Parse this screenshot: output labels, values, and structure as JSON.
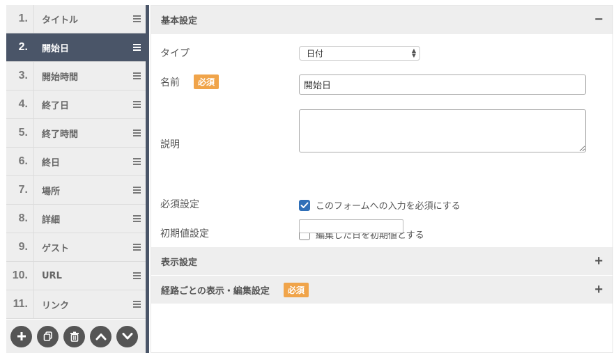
{
  "fields": [
    {
      "num": "1.",
      "label": "タイトル"
    },
    {
      "num": "2.",
      "label": "開始日"
    },
    {
      "num": "3.",
      "label": "開始時間"
    },
    {
      "num": "4.",
      "label": "終了日"
    },
    {
      "num": "5.",
      "label": "終了時間"
    },
    {
      "num": "6.",
      "label": "終日"
    },
    {
      "num": "7.",
      "label": "場所"
    },
    {
      "num": "8.",
      "label": "詳細"
    },
    {
      "num": "9.",
      "label": "ゲスト"
    },
    {
      "num": "10.",
      "label": "URL"
    },
    {
      "num": "11.",
      "label": "リンク"
    }
  ],
  "list_actions": [
    "add-icon",
    "copy-icon",
    "trash-icon",
    "chevron-up-icon",
    "chevron-down-icon"
  ],
  "basic_section": {
    "title": "基本設定",
    "toggle": "−",
    "type_label": "タイプ",
    "type_value": "日付",
    "name_label": "名前",
    "required_badge": "必須",
    "name_value": "開始日",
    "desc_label": "説明",
    "desc_value": "",
    "required_label": "必須設定",
    "required_check_label": "このフォームへの入力を必須にする",
    "required_checked": true,
    "initial_label": "初期値設定",
    "initial_check_label": "編集した日を初期値とする",
    "initial_checked": false,
    "initial_value": ""
  },
  "display_section": {
    "title": "表示設定",
    "toggle": "+"
  },
  "route_section": {
    "title": "経路ごとの表示・編集設定",
    "badge": "必須",
    "toggle": "+"
  },
  "colors": {
    "active_row": "#4a5568",
    "badge": "#f0a44a",
    "checkbox": "#2f6fb8"
  }
}
